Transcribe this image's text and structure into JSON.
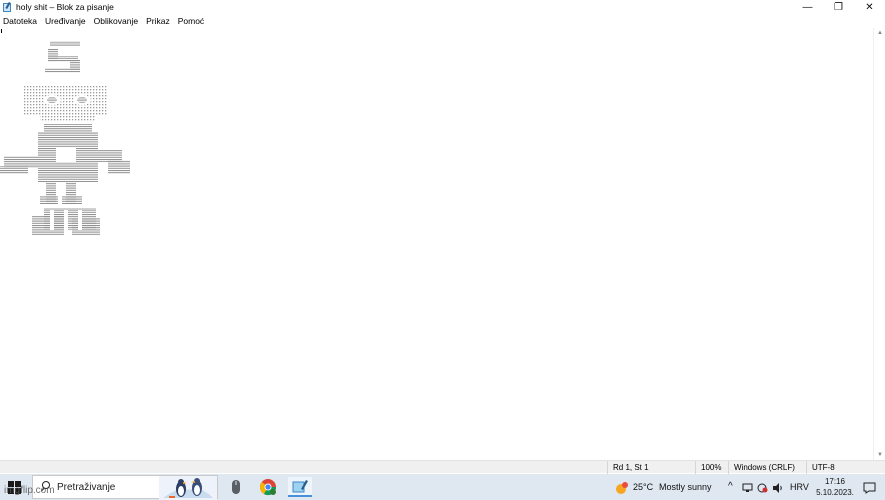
{
  "window": {
    "title": "holy shit – Blok za pisanje",
    "minimize_glyph": "—",
    "maximize_glyph": "❐",
    "close_glyph": "✕"
  },
  "menu": {
    "items": [
      "Datoteka",
      "Uređivanje",
      "Oblikovanje",
      "Prikaz",
      "Pomoć"
    ]
  },
  "statusbar": {
    "position": "Rd 1, St 1",
    "zoom": "100%",
    "line_ending": "Windows (CRLF)",
    "encoding": "UTF-8"
  },
  "taskbar": {
    "search_placeholder": "Pretraživanje",
    "weather_temp": "25°C",
    "weather_text": "Mostly sunny",
    "language": "HRV",
    "time": "17:16",
    "date": "5.10.2023.",
    "tray_chevron": "^"
  },
  "watermark": "imgflip.com",
  "colors": {
    "taskbar_bg": "#dfe7f0",
    "statusbar_bg": "#f0f0f0",
    "accent": "#4a90d9"
  }
}
